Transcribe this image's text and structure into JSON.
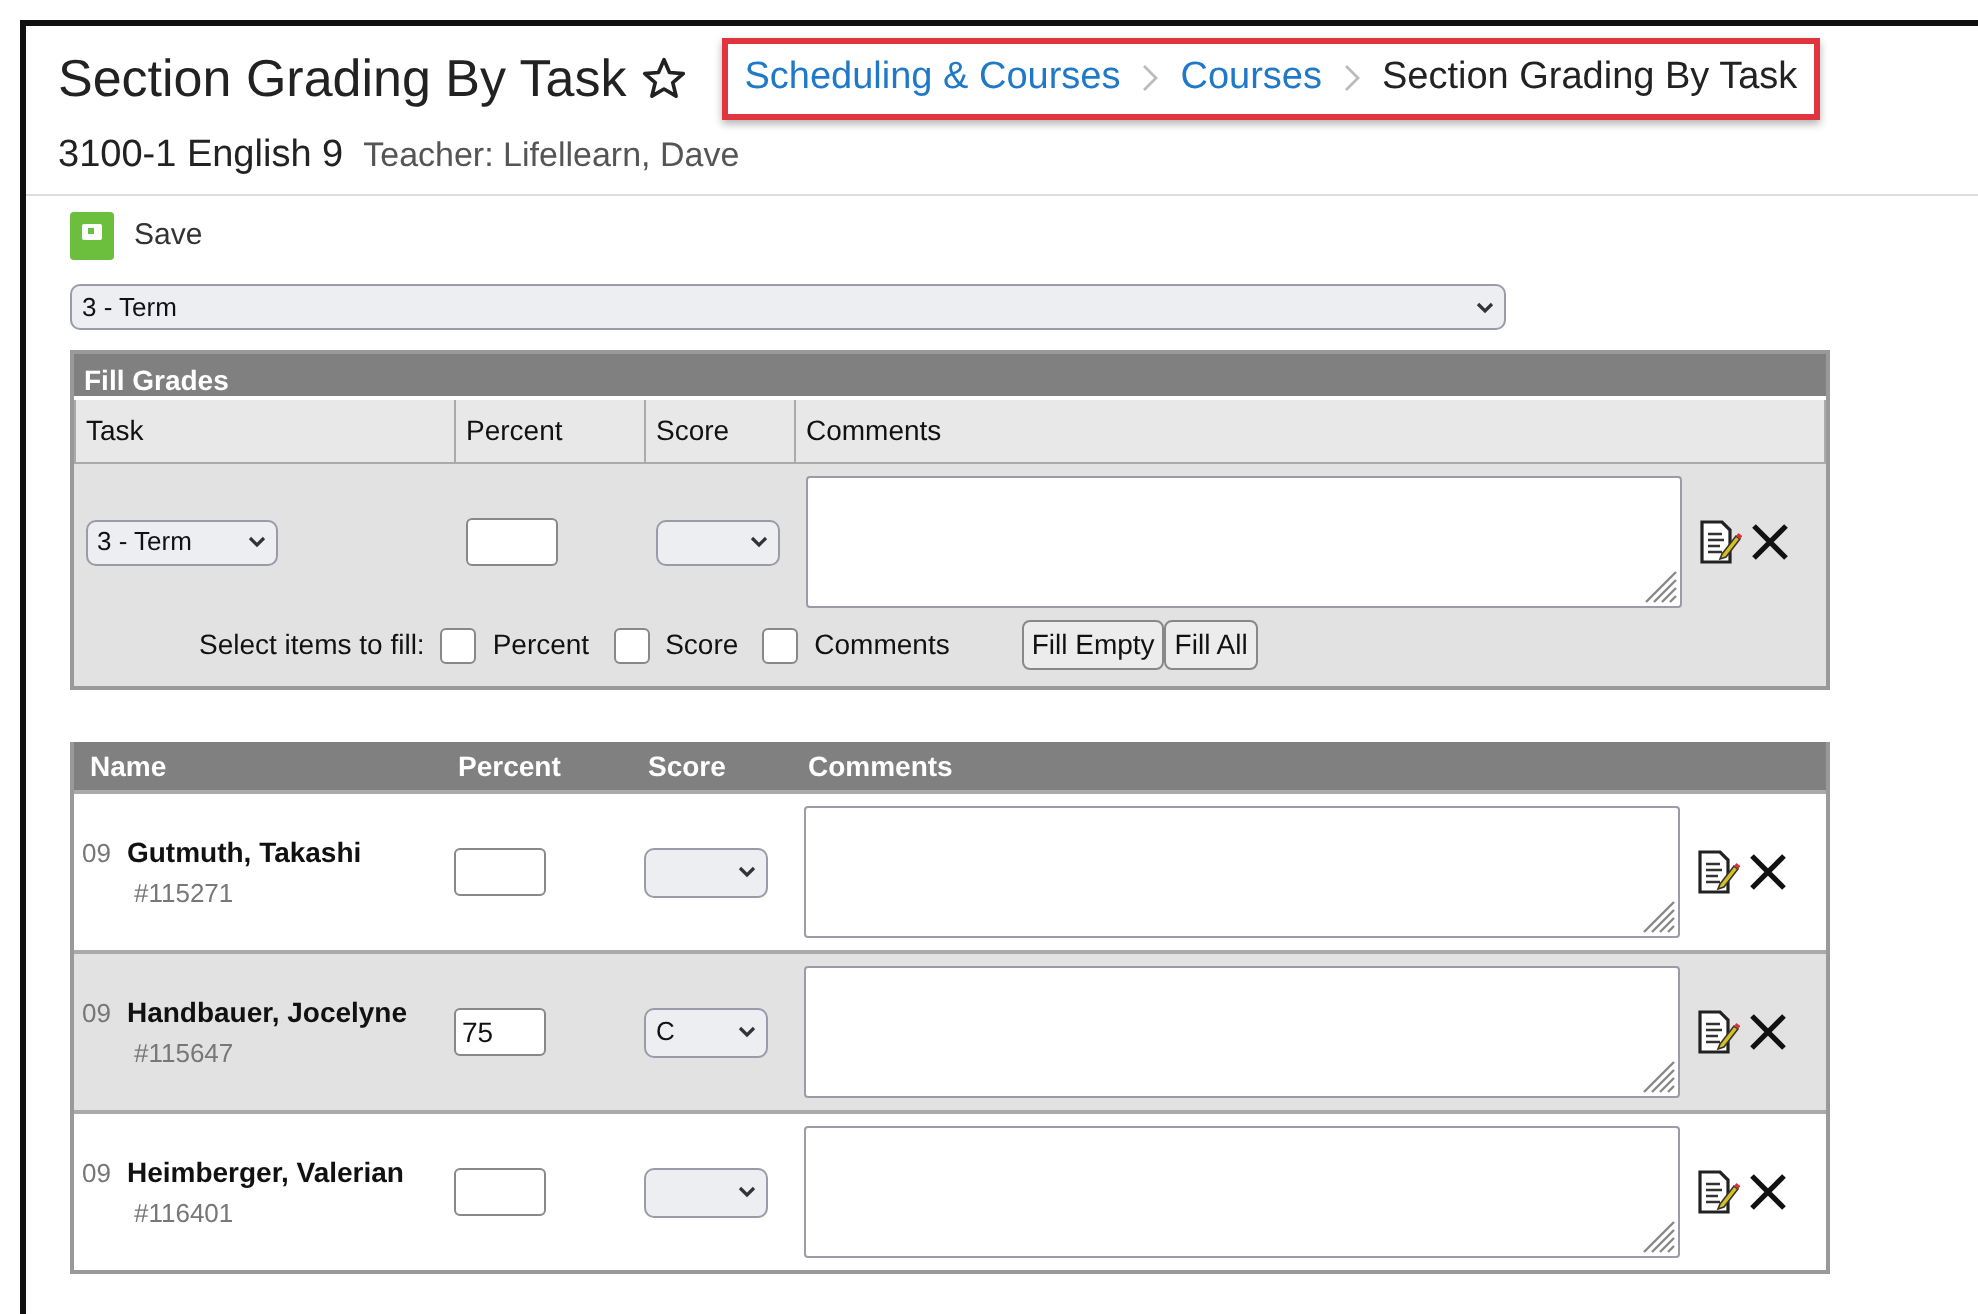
{
  "header": {
    "title": "Section Grading By Task",
    "favorite": false,
    "breadcrumbs": [
      {
        "label": "Scheduling & Courses",
        "link": true
      },
      {
        "label": "Courses",
        "link": true
      },
      {
        "label": "Section Grading By Task",
        "link": false
      }
    ],
    "section": "3100-1 English 9",
    "teacher": "Teacher: Lifellearn, Dave"
  },
  "toolbar": {
    "save": "Save"
  },
  "term_select": "3 - Term",
  "fill_grades": {
    "title": "Fill Grades",
    "columns": [
      "Task",
      "Percent",
      "Score",
      "Comments"
    ],
    "task": "3 - Term",
    "select_label": "Select items to fill:",
    "options": [
      {
        "label": "Percent",
        "checked": false
      },
      {
        "label": "Score",
        "checked": false
      },
      {
        "label": "Comments",
        "checked": false
      }
    ],
    "buttons": [
      "Fill Empty",
      "Fill All"
    ]
  },
  "students": {
    "columns": [
      "Name",
      "Percent",
      "Score",
      "Comments"
    ],
    "rows": [
      {
        "grade": "09",
        "name": "Gutmuth, Takashi",
        "id": "#115271"
      },
      {
        "grade": "09",
        "name": "Handbauer, Jocelyne",
        "id": "#115647",
        "percent": "75",
        "score": "C"
      },
      {
        "grade": "09",
        "name": "Heimberger, Valerian",
        "id": "#116401"
      }
    ]
  }
}
